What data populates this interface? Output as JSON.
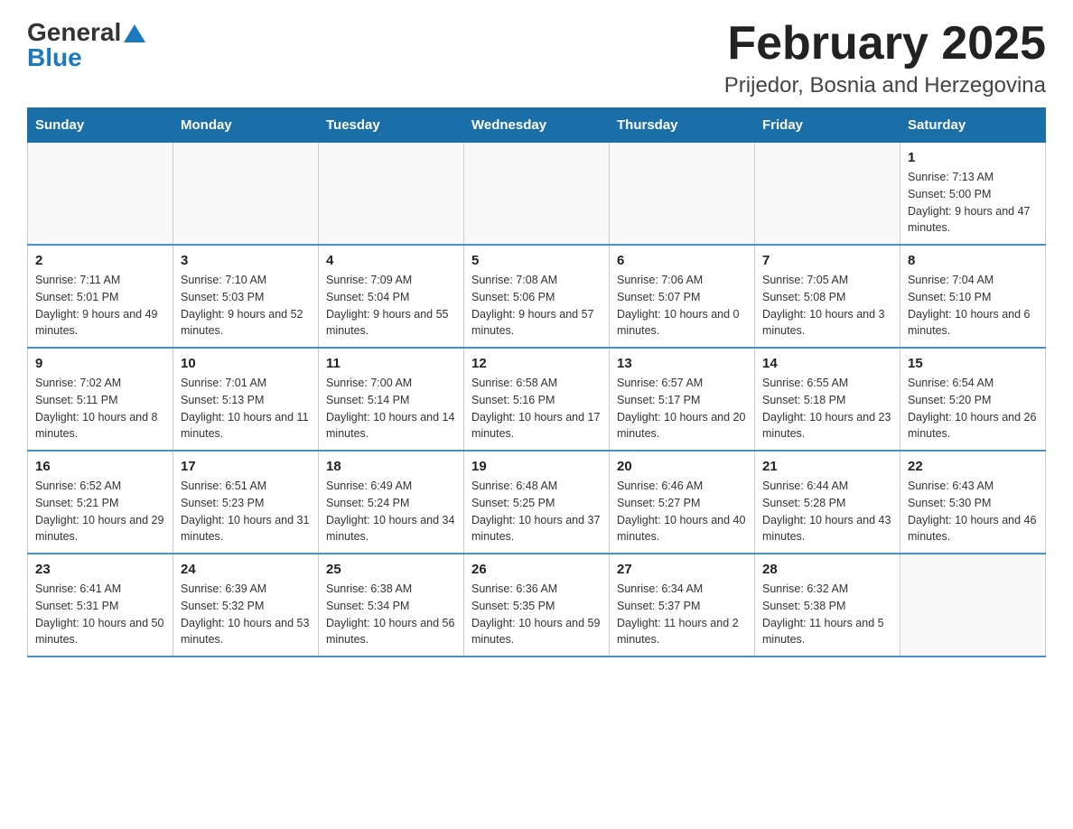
{
  "header": {
    "logo_general": "General",
    "logo_blue": "Blue",
    "title": "February 2025",
    "subtitle": "Prijedor, Bosnia and Herzegovina"
  },
  "weekdays": [
    "Sunday",
    "Monday",
    "Tuesday",
    "Wednesday",
    "Thursday",
    "Friday",
    "Saturday"
  ],
  "weeks": [
    [
      {
        "day": "",
        "info": ""
      },
      {
        "day": "",
        "info": ""
      },
      {
        "day": "",
        "info": ""
      },
      {
        "day": "",
        "info": ""
      },
      {
        "day": "",
        "info": ""
      },
      {
        "day": "",
        "info": ""
      },
      {
        "day": "1",
        "info": "Sunrise: 7:13 AM\nSunset: 5:00 PM\nDaylight: 9 hours and 47 minutes."
      }
    ],
    [
      {
        "day": "2",
        "info": "Sunrise: 7:11 AM\nSunset: 5:01 PM\nDaylight: 9 hours and 49 minutes."
      },
      {
        "day": "3",
        "info": "Sunrise: 7:10 AM\nSunset: 5:03 PM\nDaylight: 9 hours and 52 minutes."
      },
      {
        "day": "4",
        "info": "Sunrise: 7:09 AM\nSunset: 5:04 PM\nDaylight: 9 hours and 55 minutes."
      },
      {
        "day": "5",
        "info": "Sunrise: 7:08 AM\nSunset: 5:06 PM\nDaylight: 9 hours and 57 minutes."
      },
      {
        "day": "6",
        "info": "Sunrise: 7:06 AM\nSunset: 5:07 PM\nDaylight: 10 hours and 0 minutes."
      },
      {
        "day": "7",
        "info": "Sunrise: 7:05 AM\nSunset: 5:08 PM\nDaylight: 10 hours and 3 minutes."
      },
      {
        "day": "8",
        "info": "Sunrise: 7:04 AM\nSunset: 5:10 PM\nDaylight: 10 hours and 6 minutes."
      }
    ],
    [
      {
        "day": "9",
        "info": "Sunrise: 7:02 AM\nSunset: 5:11 PM\nDaylight: 10 hours and 8 minutes."
      },
      {
        "day": "10",
        "info": "Sunrise: 7:01 AM\nSunset: 5:13 PM\nDaylight: 10 hours and 11 minutes."
      },
      {
        "day": "11",
        "info": "Sunrise: 7:00 AM\nSunset: 5:14 PM\nDaylight: 10 hours and 14 minutes."
      },
      {
        "day": "12",
        "info": "Sunrise: 6:58 AM\nSunset: 5:16 PM\nDaylight: 10 hours and 17 minutes."
      },
      {
        "day": "13",
        "info": "Sunrise: 6:57 AM\nSunset: 5:17 PM\nDaylight: 10 hours and 20 minutes."
      },
      {
        "day": "14",
        "info": "Sunrise: 6:55 AM\nSunset: 5:18 PM\nDaylight: 10 hours and 23 minutes."
      },
      {
        "day": "15",
        "info": "Sunrise: 6:54 AM\nSunset: 5:20 PM\nDaylight: 10 hours and 26 minutes."
      }
    ],
    [
      {
        "day": "16",
        "info": "Sunrise: 6:52 AM\nSunset: 5:21 PM\nDaylight: 10 hours and 29 minutes."
      },
      {
        "day": "17",
        "info": "Sunrise: 6:51 AM\nSunset: 5:23 PM\nDaylight: 10 hours and 31 minutes."
      },
      {
        "day": "18",
        "info": "Sunrise: 6:49 AM\nSunset: 5:24 PM\nDaylight: 10 hours and 34 minutes."
      },
      {
        "day": "19",
        "info": "Sunrise: 6:48 AM\nSunset: 5:25 PM\nDaylight: 10 hours and 37 minutes."
      },
      {
        "day": "20",
        "info": "Sunrise: 6:46 AM\nSunset: 5:27 PM\nDaylight: 10 hours and 40 minutes."
      },
      {
        "day": "21",
        "info": "Sunrise: 6:44 AM\nSunset: 5:28 PM\nDaylight: 10 hours and 43 minutes."
      },
      {
        "day": "22",
        "info": "Sunrise: 6:43 AM\nSunset: 5:30 PM\nDaylight: 10 hours and 46 minutes."
      }
    ],
    [
      {
        "day": "23",
        "info": "Sunrise: 6:41 AM\nSunset: 5:31 PM\nDaylight: 10 hours and 50 minutes."
      },
      {
        "day": "24",
        "info": "Sunrise: 6:39 AM\nSunset: 5:32 PM\nDaylight: 10 hours and 53 minutes."
      },
      {
        "day": "25",
        "info": "Sunrise: 6:38 AM\nSunset: 5:34 PM\nDaylight: 10 hours and 56 minutes."
      },
      {
        "day": "26",
        "info": "Sunrise: 6:36 AM\nSunset: 5:35 PM\nDaylight: 10 hours and 59 minutes."
      },
      {
        "day": "27",
        "info": "Sunrise: 6:34 AM\nSunset: 5:37 PM\nDaylight: 11 hours and 2 minutes."
      },
      {
        "day": "28",
        "info": "Sunrise: 6:32 AM\nSunset: 5:38 PM\nDaylight: 11 hours and 5 minutes."
      },
      {
        "day": "",
        "info": ""
      }
    ]
  ]
}
